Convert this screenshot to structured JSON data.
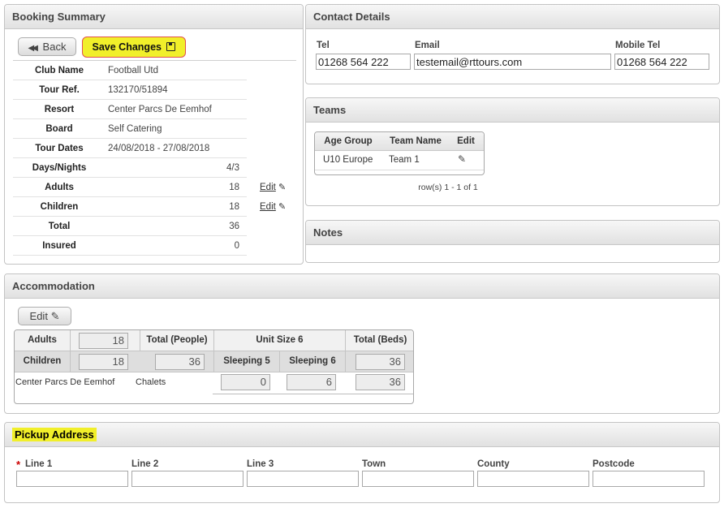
{
  "booking_summary": {
    "title": "Booking Summary",
    "back_label": "Back",
    "save_label": "Save Changes",
    "rows": [
      {
        "label": "Club Name",
        "value": "Football Utd"
      },
      {
        "label": "Tour Ref.",
        "value": "132170/51894"
      },
      {
        "label": "Resort",
        "value": "Center Parcs De Eemhof"
      },
      {
        "label": "Board",
        "value": "Self Catering"
      },
      {
        "label": "Tour Dates",
        "value": "24/08/2018 - 27/08/2018"
      },
      {
        "label": "Days/Nights",
        "value": "4/3"
      },
      {
        "label": "Adults",
        "value": "18",
        "edit": "Edit"
      },
      {
        "label": "Children",
        "value": "18",
        "edit": "Edit"
      },
      {
        "label": "Total",
        "value": "36"
      },
      {
        "label": "Insured",
        "value": "0"
      }
    ]
  },
  "contact": {
    "title": "Contact Details",
    "tel_label": "Tel",
    "tel_value": "01268 564 222",
    "email_label": "Email",
    "email_value": "testemail@rttours.com",
    "mobile_label": "Mobile Tel",
    "mobile_value": "01268 564 222"
  },
  "teams": {
    "title": "Teams",
    "headers": [
      "Age Group",
      "Team Name",
      "Edit"
    ],
    "rows": [
      {
        "age_group": "U10 Europe",
        "team_name": "Team 1"
      }
    ],
    "pager": "row(s) 1 - 1 of 1"
  },
  "notes": {
    "title": "Notes"
  },
  "accommodation": {
    "title": "Accommodation",
    "edit_label": "Edit",
    "adults_label": "Adults",
    "adults_value": "18",
    "children_label": "Children",
    "children_value": "18",
    "total_people_label": "Total (People)",
    "total_people_value": "36",
    "unit_size_label": "Unit Size 6",
    "sleeping5_label": "Sleeping 5",
    "sleeping6_label": "Sleeping 6",
    "total_beds_label": "Total (Beds)",
    "total_beds_value": "36",
    "resort": "Center Parcs De Eemhof",
    "unit_type": "Chalets",
    "sleeping5_value": "0",
    "sleeping6_value": "6",
    "beds_row_value": "36"
  },
  "pickup": {
    "title": "Pickup Address",
    "required_mark": "*",
    "fields": [
      "Line 1",
      "Line 2",
      "Line 3",
      "Town",
      "County",
      "Postcode"
    ]
  },
  "colors": {
    "highlight": "#f1ef2a",
    "required": "#cc0000",
    "save_border": "#e05050"
  }
}
